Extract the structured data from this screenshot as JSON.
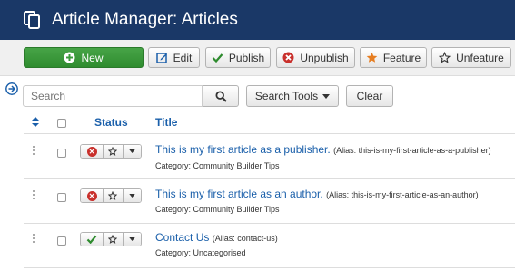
{
  "header": {
    "title": "Article Manager: Articles"
  },
  "toolbar": {
    "new_label": "New",
    "edit_label": "Edit",
    "publish_label": "Publish",
    "unpublish_label": "Unpublish",
    "feature_label": "Feature",
    "unfeature_label": "Unfeature"
  },
  "filter": {
    "search_placeholder": "Search",
    "search_tools_label": "Search Tools",
    "clear_label": "Clear"
  },
  "table": {
    "col_status": "Status",
    "col_title": "Title",
    "rows": [
      {
        "title": "This is my first article as a publisher.",
        "alias": "(Alias: this-is-my-first-article-as-a-publisher)",
        "category": "Category: Community Builder Tips",
        "status": "unpublished"
      },
      {
        "title": "This is my first article as an author.",
        "alias": "(Alias: this-is-my-first-article-as-an-author)",
        "category": "Category: Community Builder Tips",
        "status": "unpublished"
      },
      {
        "title": "Contact Us",
        "alias": "(Alias: contact-us)",
        "category": "Category: Uncategorised",
        "status": "published"
      }
    ]
  },
  "colors": {
    "header_bg": "#1a3867",
    "new_button": "#3c9a3c",
    "link": "#1a5faa",
    "unpublished": "#c9302c",
    "published": "#2e8b2e",
    "feature_star": "#e67e22"
  }
}
